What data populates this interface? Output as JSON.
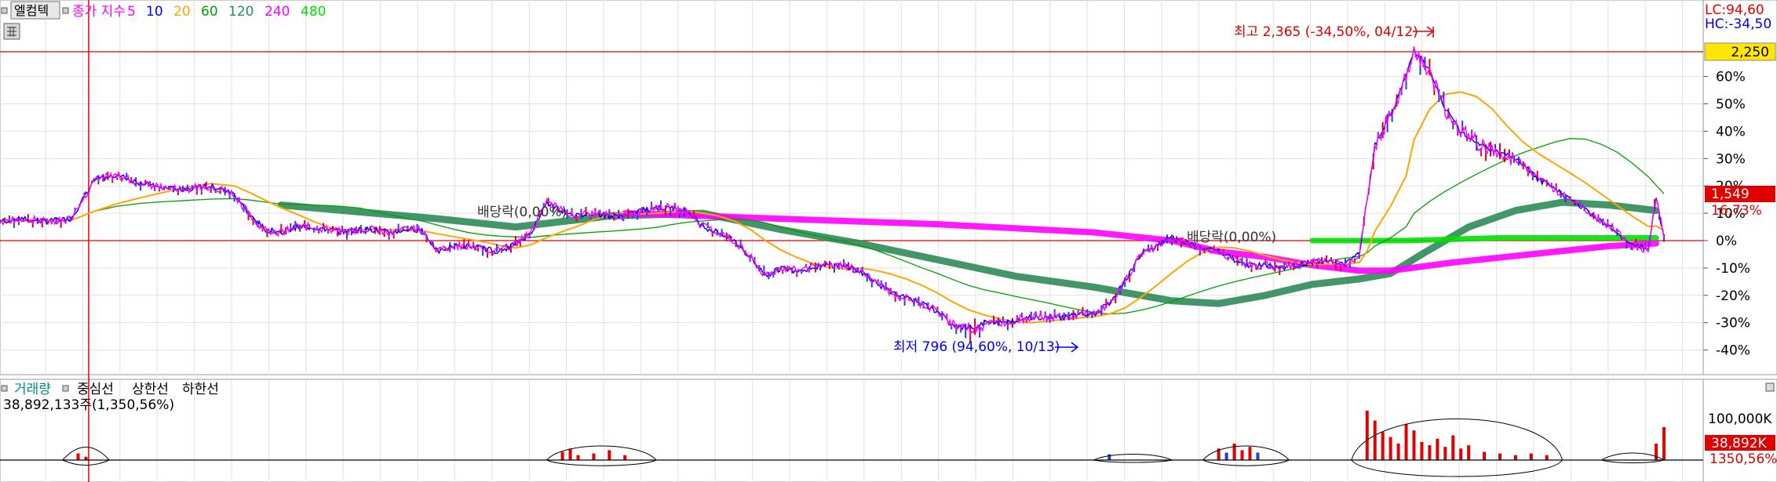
{
  "price_panel": {
    "badge_label": "엘컴텍",
    "indicator_title": "종가 지수",
    "ma_periods": [
      "5",
      "10",
      "20",
      "60",
      "120",
      "240",
      "480"
    ],
    "ma_colors": [
      "#ff00ff",
      "#0000ff",
      "#ffa500",
      "#00a000",
      "#2e8b57",
      "#ff00ff",
      "#00e000"
    ],
    "lc_label": "LC:94,60",
    "hc_label": "HC:-34,50",
    "ref_price_label": "2,250",
    "current_price_label": "1,549",
    "current_change_label": "16,73%",
    "high_annotation": "최고 2,365 (-34,50%, 04/12)",
    "low_annotation": "최저 796 (94,60%, 10/13)",
    "dividend_label_1": "배당락(0,00%)",
    "dividend_label_2": "배당락(0,00%)"
  },
  "volume_panel": {
    "title": "거래량",
    "band_labels": [
      "중심선",
      "상한선",
      "하한선"
    ],
    "total_label": "38,892,133주(1,350,56%)",
    "axis_label": "100,000K",
    "current_volume_label": "38,892K",
    "current_volume_pct_label": "1350,56%"
  },
  "chart_data": {
    "type": "line",
    "title": "종가 지수",
    "series_name": "엘컴텍",
    "y_unit": "% relative to reference price 2,250",
    "y_ticks": [
      "60%",
      "50%",
      "40%",
      "30%",
      "20%",
      "10%",
      "0%",
      "-10%",
      "-20%",
      "-30%",
      "-40%"
    ],
    "y_tick_values": [
      60,
      50,
      40,
      30,
      20,
      10,
      0,
      -10,
      -20,
      -30,
      -40
    ],
    "ylim": [
      -48,
      78
    ],
    "reference_price": 2250,
    "high": {
      "price": 2365,
      "label_pct": -34.5,
      "date": "04/12"
    },
    "low": {
      "price": 796,
      "label_pct": 94.6,
      "date": "10/13"
    },
    "last": {
      "price": 1549,
      "pct": 16.73
    },
    "index_points": [
      [
        0,
        7
      ],
      [
        3,
        8
      ],
      [
        6,
        7
      ],
      [
        9,
        8
      ],
      [
        10,
        12
      ],
      [
        12,
        22
      ],
      [
        15,
        24
      ],
      [
        18,
        21
      ],
      [
        21,
        19
      ],
      [
        24,
        19
      ],
      [
        27,
        20
      ],
      [
        30,
        17
      ],
      [
        32,
        9
      ],
      [
        34,
        4
      ],
      [
        36,
        3
      ],
      [
        38,
        5
      ],
      [
        40,
        5
      ],
      [
        42,
        4
      ],
      [
        44,
        3
      ],
      [
        46,
        4
      ],
      [
        48,
        4
      ],
      [
        50,
        3
      ],
      [
        52,
        4
      ],
      [
        54,
        4
      ],
      [
        56,
        -4
      ],
      [
        58,
        -2
      ],
      [
        60,
        -2
      ],
      [
        62,
        -3
      ],
      [
        64,
        -4
      ],
      [
        66,
        -1
      ],
      [
        68,
        3
      ],
      [
        70,
        14
      ],
      [
        72,
        11
      ],
      [
        74,
        9
      ],
      [
        76,
        10
      ],
      [
        78,
        9
      ],
      [
        80,
        9
      ],
      [
        82,
        11
      ],
      [
        84,
        12
      ],
      [
        86,
        12
      ],
      [
        88,
        11
      ],
      [
        90,
        5
      ],
      [
        92,
        3
      ],
      [
        94,
        0
      ],
      [
        96,
        -6
      ],
      [
        98,
        -13
      ],
      [
        100,
        -10
      ],
      [
        102,
        -11
      ],
      [
        104,
        -10
      ],
      [
        106,
        -9
      ],
      [
        108,
        -9
      ],
      [
        110,
        -11
      ],
      [
        112,
        -15
      ],
      [
        114,
        -19
      ],
      [
        116,
        -21
      ],
      [
        118,
        -23
      ],
      [
        120,
        -26
      ],
      [
        122,
        -31
      ],
      [
        124,
        -32
      ],
      [
        126,
        -30
      ],
      [
        128,
        -30
      ],
      [
        130,
        -29
      ],
      [
        132,
        -28
      ],
      [
        134,
        -28
      ],
      [
        136,
        -28
      ],
      [
        138,
        -27
      ],
      [
        140,
        -27
      ],
      [
        142,
        -23
      ],
      [
        144,
        -15
      ],
      [
        146,
        -5
      ],
      [
        148,
        -2
      ],
      [
        150,
        1
      ],
      [
        152,
        -1
      ],
      [
        154,
        -3
      ],
      [
        156,
        -4
      ],
      [
        158,
        -7
      ],
      [
        160,
        -9
      ],
      [
        162,
        -9
      ],
      [
        164,
        -10
      ],
      [
        166,
        -9
      ],
      [
        168,
        -8
      ],
      [
        170,
        -7
      ],
      [
        172,
        -9
      ],
      [
        174,
        -5
      ],
      [
        175,
        15
      ],
      [
        176,
        35
      ],
      [
        178,
        46
      ],
      [
        180,
        60
      ],
      [
        181,
        70
      ],
      [
        183,
        62
      ],
      [
        185,
        48
      ],
      [
        187,
        40
      ],
      [
        189,
        36
      ],
      [
        191,
        33
      ],
      [
        193,
        31
      ],
      [
        195,
        28
      ],
      [
        197,
        22
      ],
      [
        199,
        19
      ],
      [
        201,
        15
      ],
      [
        203,
        11
      ],
      [
        205,
        7
      ],
      [
        207,
        3
      ],
      [
        209,
        -2
      ],
      [
        211,
        -3
      ],
      [
        212,
        16
      ],
      [
        213,
        1
      ]
    ],
    "ma_series": [
      {
        "period": "5",
        "color": "#ff00ff"
      },
      {
        "period": "10",
        "color": "#0000ff"
      },
      {
        "period": "20",
        "color": "#ffa500"
      },
      {
        "period": "60",
        "color": "#00a000"
      },
      {
        "period": "120",
        "color": "#2e8b57",
        "points": [
          [
            36,
            13
          ],
          [
            48,
            10
          ],
          [
            56,
            8
          ],
          [
            66,
            5
          ],
          [
            78,
            9
          ],
          [
            90,
            10
          ],
          [
            100,
            4
          ],
          [
            110,
            -1
          ],
          [
            120,
            -7
          ],
          [
            130,
            -13
          ],
          [
            140,
            -17
          ],
          [
            150,
            -22
          ],
          [
            156,
            -23
          ],
          [
            162,
            -20
          ],
          [
            168,
            -16
          ],
          [
            174,
            -14
          ],
          [
            178,
            -12
          ],
          [
            182,
            -5
          ],
          [
            188,
            5
          ],
          [
            194,
            11
          ],
          [
            200,
            14
          ],
          [
            206,
            13
          ],
          [
            212,
            11
          ]
        ]
      },
      {
        "period": "240",
        "color": "#ff00ff",
        "points": [
          [
            80,
            10
          ],
          [
            100,
            8
          ],
          [
            120,
            6
          ],
          [
            140,
            3
          ],
          [
            150,
            0
          ],
          [
            156,
            -4
          ],
          [
            162,
            -6
          ],
          [
            168,
            -9
          ],
          [
            174,
            -11
          ],
          [
            178,
            -11
          ],
          [
            186,
            -8
          ],
          [
            196,
            -5
          ],
          [
            206,
            -2
          ],
          [
            212,
            -1
          ]
        ]
      },
      {
        "period": "480",
        "color": "#00e000",
        "points": [
          [
            168,
            0
          ],
          [
            180,
            0
          ],
          [
            192,
            1
          ],
          [
            204,
            1
          ],
          [
            212,
            1
          ]
        ]
      }
    ],
    "volume": {
      "unit": "K shares",
      "tick_label": "100,000K",
      "last_value": 38892,
      "bars": [
        [
          10,
          8
        ],
        [
          11,
          4
        ],
        [
          72,
          10
        ],
        [
          73,
          14
        ],
        [
          74,
          6
        ],
        [
          76,
          8
        ],
        [
          78,
          12
        ],
        [
          80,
          6
        ],
        [
          142,
          7
        ],
        [
          156,
          14
        ],
        [
          157,
          9
        ],
        [
          158,
          20
        ],
        [
          159,
          12
        ],
        [
          160,
          16
        ],
        [
          161,
          9
        ],
        [
          175,
          60
        ],
        [
          176,
          48
        ],
        [
          177,
          34
        ],
        [
          178,
          28
        ],
        [
          179,
          20
        ],
        [
          180,
          44
        ],
        [
          181,
          36
        ],
        [
          182,
          22
        ],
        [
          183,
          18
        ],
        [
          184,
          26
        ],
        [
          185,
          16
        ],
        [
          186,
          30
        ],
        [
          187,
          14
        ],
        [
          188,
          18
        ],
        [
          190,
          10
        ],
        [
          192,
          8
        ],
        [
          194,
          6
        ],
        [
          196,
          8
        ],
        [
          198,
          6
        ],
        [
          212,
          20
        ],
        [
          213,
          40
        ]
      ]
    }
  }
}
